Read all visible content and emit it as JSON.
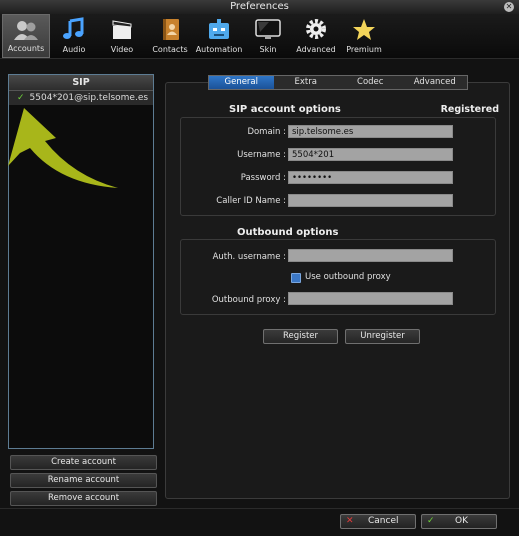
{
  "window": {
    "title": "Preferences"
  },
  "toolbar": {
    "items": [
      {
        "label": "Accounts",
        "icon": "accounts-icon",
        "active": true
      },
      {
        "label": "Audio",
        "icon": "music-note-icon"
      },
      {
        "label": "Video",
        "icon": "clapperboard-icon"
      },
      {
        "label": "Contacts",
        "icon": "contacts-book-icon"
      },
      {
        "label": "Automation",
        "icon": "robot-icon"
      },
      {
        "label": "Skin",
        "icon": "monitor-icon"
      },
      {
        "label": "Advanced",
        "icon": "gear-icon"
      },
      {
        "label": "Premium",
        "icon": "star-icon"
      }
    ]
  },
  "accounts": {
    "header": "SIP",
    "items": [
      {
        "label": "5504*201@sip.telsome.es",
        "checked": true
      }
    ],
    "create_label": "Create account",
    "rename_label": "Rename account",
    "remove_label": "Remove account"
  },
  "tabs": [
    {
      "label": "General",
      "active": true
    },
    {
      "label": "Extra"
    },
    {
      "label": "Codec"
    },
    {
      "label": "Advanced"
    }
  ],
  "sip": {
    "title": "SIP account options",
    "status": "Registered",
    "domain_label": "Domain :",
    "domain_value": "sip.telsome.es",
    "username_label": "Username :",
    "username_value": "5504*201",
    "password_label": "Password :",
    "password_value": "••••••••",
    "caller_id_label": "Caller ID Name :",
    "caller_id_value": ""
  },
  "outbound": {
    "title": "Outbound options",
    "auth_label": "Auth. username :",
    "auth_value": "",
    "use_proxy_label": "Use outbound proxy",
    "use_proxy_checked": true,
    "proxy_label": "Outbound proxy :",
    "proxy_value": ""
  },
  "actions": {
    "register_label": "Register",
    "unregister_label": "Unregister"
  },
  "dialog": {
    "cancel_label": "Cancel",
    "ok_label": "OK"
  },
  "colors": {
    "accent": "#2f76c8",
    "arrow": "#a8b61a",
    "check": "#6fd33a",
    "cancel": "#e23b3b"
  }
}
